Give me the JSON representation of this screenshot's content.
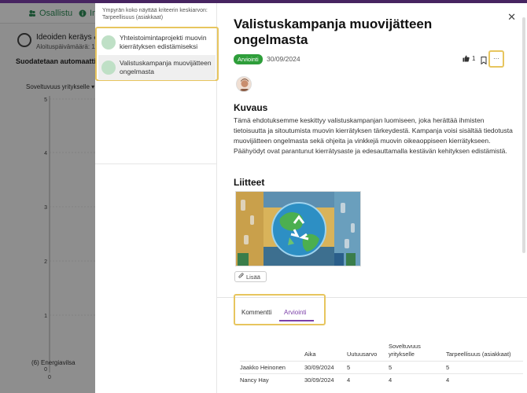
{
  "background": {
    "tabs": [
      "Osallistu",
      "In"
    ],
    "idea_title": "Ideoiden keräys & yhte",
    "idea_subtitle": "Aloituspäivämäärä: 11/10/2",
    "filter_text": "Suodatetaan automaattisesti",
    "dropdown_label": "Soveltuvuus yritykselle",
    "y_ticks": [
      "5",
      "4",
      "3",
      "2",
      "1",
      "0"
    ],
    "legend_text": "(6) Energiavilsa",
    "x_tick": "0"
  },
  "panel": {
    "hint": "Ympyrän koko näyttää kriteerin keskiarvon: Tarpeellisuus (asiakkaat)",
    "list_items": [
      {
        "label": "Yhteistoimintaprojekti muovin kierrätyksen edistämiseksi"
      },
      {
        "label": "Valistuskampanja muovijätteen ongelmasta"
      }
    ],
    "title": "Valistuskampanja muovijätteen ongelmasta",
    "status_badge": "Arviointi",
    "date": "30/09/2024",
    "likes": "1",
    "more_label": "···",
    "description_heading": "Kuvaus",
    "description": "Tämä ehdotuksemme keskittyy valistuskampanjan luomiseen, joka herättää ihmisten tietoisuutta ja sitoutumista muovin kierrätyksen tärkeydestä. Kampanja voisi sisältää tiedotusta muovijätteen ongelmasta sekä ohjeita ja vinkkejä muovin oikeaoppiseen kierrätykseen. Päähyödyt ovat parantunut kierrätysaste ja edesauttamalla kestävän kehityksen edistämistä.",
    "attachments_heading": "Liitteet",
    "add_button": "Lisää",
    "tabs": [
      "Kommentti",
      "Arviointi"
    ],
    "table": {
      "headers": [
        "",
        "Aika",
        "Uutuusarvo",
        "Soveltuvuus yritykselle",
        "Tarpeellisuus (asiakkaat)"
      ],
      "rows": [
        [
          "Jaakko Heinonen",
          "30/09/2024",
          "5",
          "5",
          "5"
        ],
        [
          "Nancy Hay",
          "30/09/2024",
          "4",
          "4",
          "4"
        ]
      ]
    }
  },
  "colors": {
    "accent": "#7b3fa8",
    "status_green": "#2e9e3a",
    "highlight": "#e7c55e",
    "bubble": "#bfe0c6"
  },
  "icons": [
    "users-icon",
    "info-icon",
    "close-icon",
    "thumbs-up-icon",
    "bookmark-icon",
    "more-icon",
    "paperclip-icon",
    "chevron-down-icon"
  ]
}
